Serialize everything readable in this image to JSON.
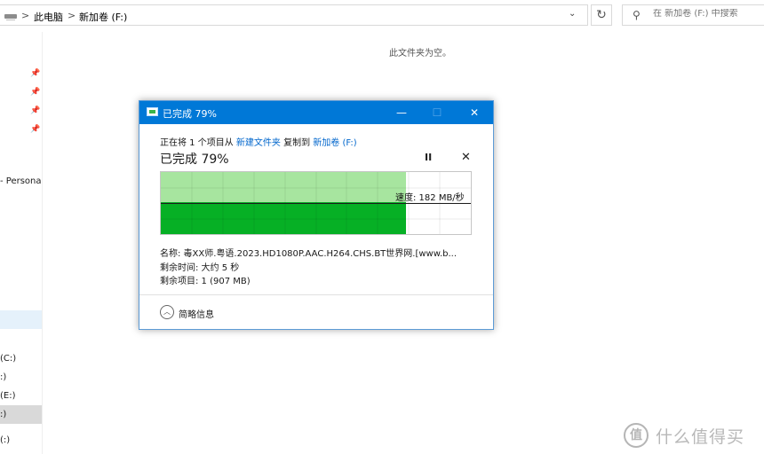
{
  "address_bar": {
    "crumbs": [
      "此电脑",
      "新加卷 (F:)"
    ],
    "separator": ">",
    "dropdown_icon": "chevron-down-icon",
    "refresh_icon": "refresh-icon"
  },
  "search": {
    "placeholder": "在 新加卷 (F:) 中搜索",
    "icon": "search-icon"
  },
  "nav_pane": {
    "pinned_count": 4,
    "items": [
      "- Persona",
      "(C:)",
      ":)",
      "(E:)",
      ":)",
      "(:)"
    ]
  },
  "content": {
    "empty_message": "此文件夹为空。"
  },
  "copy_dialog": {
    "title": "已完成 79%",
    "status_prefix": "正在将 1 个项目从 ",
    "source": "新建文件夹",
    "status_mid": " 复制到 ",
    "destination": "新加卷 (F:)",
    "progress_label": "已完成 79%",
    "progress_fraction": 0.79,
    "speed_label": "速度: 182 MB/秒",
    "name_line": "名称: 毒XX师.粤语.2023.HD1080P.AAC.H264.CHS.BT世界网.[www.b...",
    "time_line": "剩余时间: 大约 5 秒",
    "items_line": "剩余项目: 1 (907 MB)",
    "collapse_label": "简略信息",
    "pause_symbol": "II",
    "stop_symbol": "✕",
    "window_buttons": {
      "minimize": "—",
      "maximize": "☐",
      "close": "✕"
    },
    "colors": {
      "titlebar": "#0078d7",
      "fill": "#a7e59f",
      "speed": "#06b025",
      "link": "#0066cc"
    }
  },
  "watermark": {
    "logo": "值",
    "text": "什么值得买"
  }
}
